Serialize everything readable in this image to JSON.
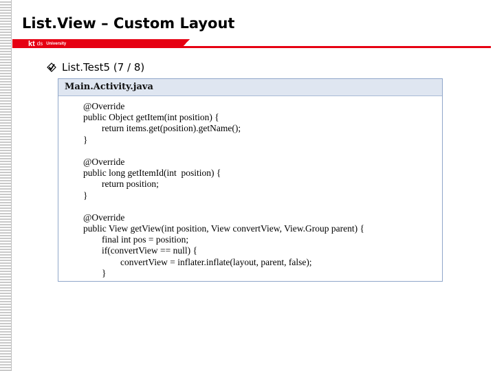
{
  "header": {
    "title": "List.View – Custom Layout",
    "logo_kt": "kt",
    "logo_ds": "ds",
    "logo_university": "University"
  },
  "bullet": {
    "icon": "diamond-checkmark-bullet",
    "text": "List.Test5 (7 / 8)"
  },
  "code": {
    "filename": "Main.Activity.java",
    "lines": [
      "@Override",
      "public Object getItem(int position) {",
      "        return items.get(position).getName();",
      "}",
      "",
      "@Override",
      "public long getItemId(int  position) {",
      "        return position;",
      "}",
      "",
      "@Override",
      "public View getView(int position, View convertView, View.Group parent) {",
      "        final int pos = position;",
      "        if(convertView == null) {",
      "                convertView = inflater.inflate(layout, parent, false);",
      "        }"
    ]
  },
  "colors": {
    "accent_red": "#e60012",
    "code_header_bg": "#dfe6f1",
    "code_border": "#8fa6c9"
  }
}
